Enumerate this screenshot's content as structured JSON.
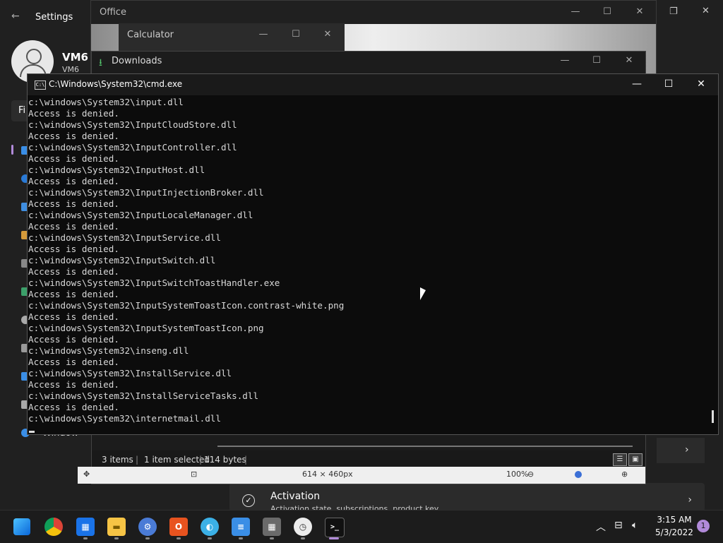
{
  "settings": {
    "title": "Settings",
    "user_name": "VM6",
    "user_sub": "VM6",
    "search_fragment": "Fi",
    "nav_fragment": "Window",
    "activation": {
      "title": "Activation",
      "subtitle": "Activation state, subscriptions, product key"
    }
  },
  "office": {
    "title": "Office"
  },
  "calculator": {
    "title": "Calculator"
  },
  "downloads": {
    "title": "Downloads",
    "status_items": "3 items",
    "status_selected": "1 item selected",
    "status_size": "114 bytes",
    "image_dims": "614 × 460px",
    "zoom": "100%"
  },
  "cmd": {
    "title": "C:\\Windows\\System32\\cmd.exe",
    "lines": [
      "c:\\windows\\System32\\input.dll",
      "Access is denied.",
      "c:\\windows\\System32\\InputCloudStore.dll",
      "Access is denied.",
      "c:\\windows\\System32\\InputController.dll",
      "Access is denied.",
      "c:\\windows\\System32\\InputHost.dll",
      "Access is denied.",
      "c:\\windows\\System32\\InputInjectionBroker.dll",
      "Access is denied.",
      "c:\\windows\\System32\\InputLocaleManager.dll",
      "Access is denied.",
      "c:\\windows\\System32\\InputService.dll",
      "Access is denied.",
      "c:\\windows\\System32\\InputSwitch.dll",
      "Access is denied.",
      "c:\\windows\\System32\\InputSwitchToastHandler.exe",
      "Access is denied.",
      "c:\\windows\\System32\\InputSystemToastIcon.contrast-white.png",
      "Access is denied.",
      "c:\\windows\\System32\\InputSystemToastIcon.png",
      "Access is denied.",
      "c:\\windows\\System32\\inseng.dll",
      "Access is denied.",
      "c:\\windows\\System32\\InstallService.dll",
      "Access is denied.",
      "c:\\windows\\System32\\InstallServiceTasks.dll",
      "Access is denied.",
      "c:\\windows\\System32\\internetmail.dll"
    ]
  },
  "taskbar": {
    "apps": [
      "start",
      "chrome",
      "calendar",
      "file-explorer",
      "settings",
      "office",
      "photos",
      "notepad",
      "calculator",
      "clock",
      "terminal"
    ],
    "time": "3:15 AM",
    "date": "5/3/2022",
    "notifications": "1"
  },
  "colors": {
    "cmd_bg": "#0c0c0c",
    "cmd_text": "#d8d8d8",
    "accent": "#b18ad9"
  }
}
